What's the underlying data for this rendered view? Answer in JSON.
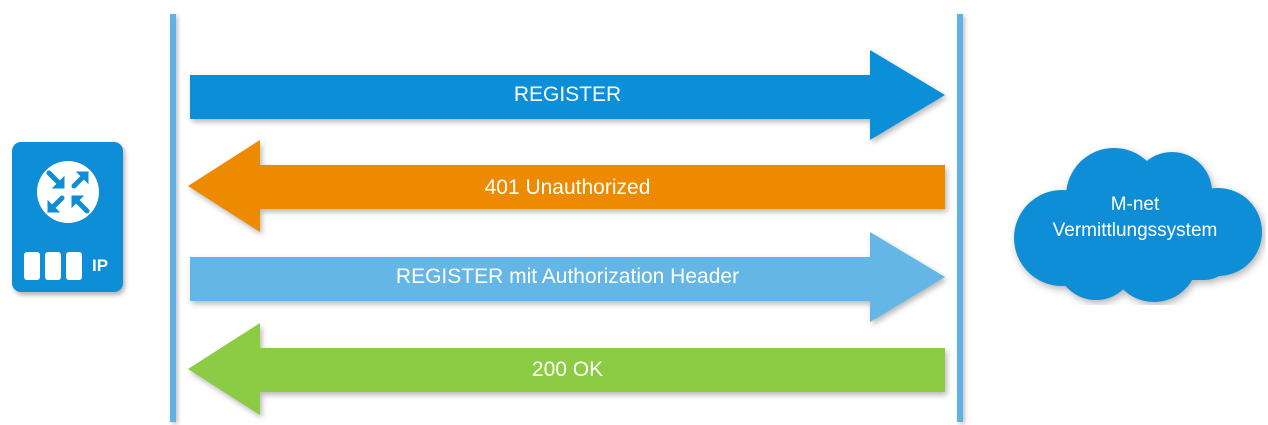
{
  "diagram": {
    "device": {
      "icon": "router-icon",
      "label": "IP",
      "color": "#0e8ed6"
    },
    "server": {
      "line1": "M-net",
      "line2": "Vermittlungssystem",
      "color": "#0e8ed6"
    },
    "lifeline_color": "#5fb2e3",
    "messages": [
      {
        "label": "REGISTER",
        "direction": "right",
        "color": "#0a8fd8"
      },
      {
        "label": "401 Unauthorized",
        "direction": "left",
        "color": "#ee8a00"
      },
      {
        "label": "REGISTER mit Authorization Header",
        "direction": "right",
        "color": "#63b6e6"
      },
      {
        "label": "200 OK",
        "direction": "left",
        "color": "#8ccc44"
      }
    ]
  }
}
